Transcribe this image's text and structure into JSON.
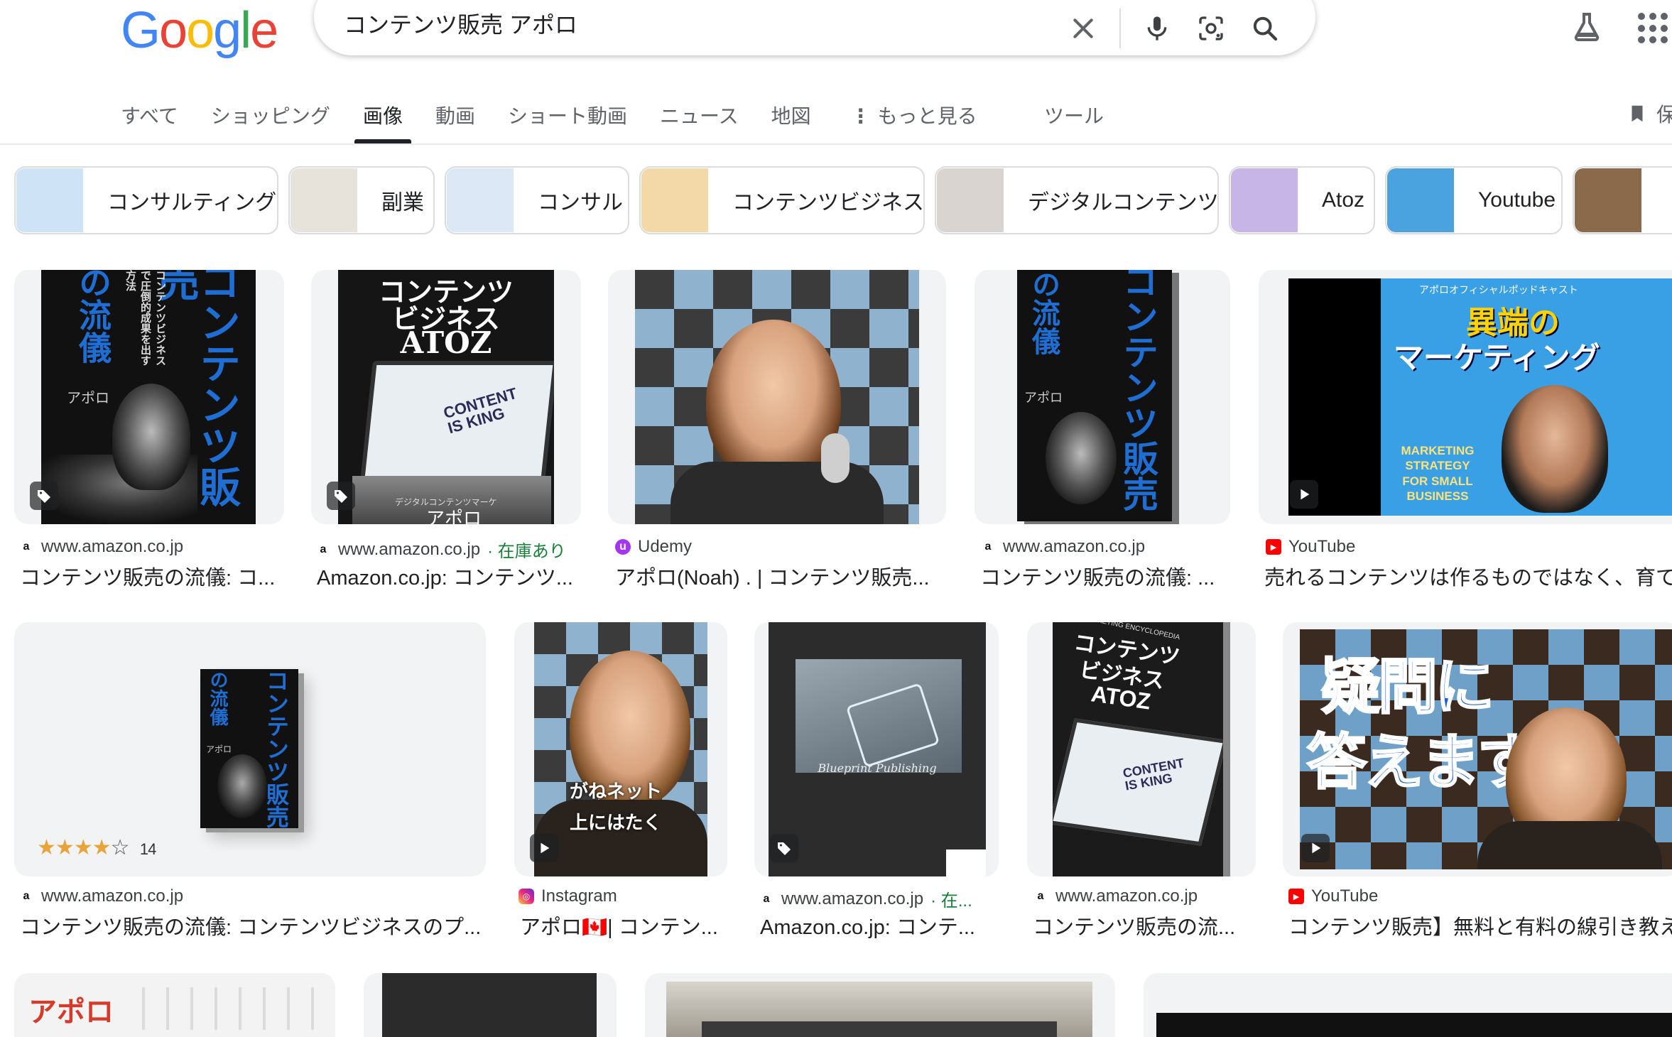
{
  "logo": {
    "letters": [
      "G",
      "o",
      "o",
      "g",
      "l",
      "e"
    ]
  },
  "search": {
    "query": "コンテンツ販売 アポロ"
  },
  "icons": {
    "clear": "close-icon",
    "voice": "microphone-icon",
    "lens": "camera-lens-icon",
    "search": "search-icon",
    "labs": "flask-icon",
    "apps": "apps-grid-icon",
    "bookmark": "bookmark-icon"
  },
  "tabs": [
    {
      "label": "すべて",
      "active": false
    },
    {
      "label": "ショッピング",
      "active": false
    },
    {
      "label": "画像",
      "active": true
    },
    {
      "label": "動画",
      "active": false
    },
    {
      "label": "ショート動画",
      "active": false
    },
    {
      "label": "ニュース",
      "active": false
    },
    {
      "label": "地図",
      "active": false
    },
    {
      "label": "もっと見る",
      "active": false
    }
  ],
  "tools_label": "ツール",
  "save_label": "保",
  "chips": [
    {
      "label": "コンサルティング",
      "color": "#cfe3f7"
    },
    {
      "label": "副業",
      "color": "#e8e3da"
    },
    {
      "label": "コンサル",
      "color": "#dce8f6"
    },
    {
      "label": "コンテンツビジネス",
      "color": "#f3d9a8"
    },
    {
      "label": "デジタルコンテンツ",
      "color": "#d9d4cf"
    },
    {
      "label": "Atoz",
      "color": "#c6b5e6"
    },
    {
      "label": "Youtube",
      "color": "#4aa3df"
    },
    {
      "label": "",
      "color": "#8a6a4a"
    }
  ],
  "results_row1": [
    {
      "source": "www.amazon.co.jp",
      "source_extra": "",
      "title": "コンテンツ販売の流儀: コ...",
      "favicon": "amazon"
    },
    {
      "source": "www.amazon.co.jp",
      "source_extra": "· 在庫あり",
      "title": "Amazon.co.jp: コンテンツ...",
      "favicon": "amazon"
    },
    {
      "source": "Udemy",
      "source_extra": "",
      "title": "アポロ(Noah) . | コンテンツ販売...",
      "favicon": "udemy"
    },
    {
      "source": "www.amazon.co.jp",
      "source_extra": "",
      "title": "コンテンツ販売の流儀: ...",
      "favicon": "amazon"
    },
    {
      "source": "YouTube",
      "source_extra": "",
      "title": "売れるコンテンツは作るものではなく、育て",
      "favicon": "youtube"
    }
  ],
  "results_row2": [
    {
      "source": "www.amazon.co.jp",
      "source_extra": "",
      "title": "コンテンツ販売の流儀: コンテンツビジネスのプ...",
      "favicon": "amazon"
    },
    {
      "source": "Instagram",
      "source_extra": "",
      "title": "アポロ🇨🇦| コンテン...",
      "favicon": "instagram"
    },
    {
      "source": "www.amazon.co.jp",
      "source_extra": "· 在...",
      "title": "Amazon.co.jp: コンテ...",
      "favicon": "amazon"
    },
    {
      "source": "www.amazon.co.jp",
      "source_extra": "",
      "title": "コンテンツ販売の流...",
      "favicon": "amazon"
    },
    {
      "source": "YouTube",
      "source_extra": "",
      "title": "コンテンツ販売】無料と有料の線引き教え",
      "favicon": "youtube"
    }
  ],
  "image_text": {
    "book1_title": "コンテンツ販売",
    "book1_sub": "の流儀",
    "book1_tagline": "コンテンツビジネスで圧倒的成果を出す方法",
    "book1_author": "アポロ",
    "atoz_title_1": "コンテンツ",
    "atoz_title_2": "ビジネス",
    "atoz_title_3": "ATOZ",
    "content_is_king": "CONTENT IS KING",
    "atoz_footer": "デジタルコンテンツマーケ",
    "atoz_author": "アポロ",
    "podcast_label": "アポロオフィシャルポッドキャスト",
    "podcast_title_1": "異端の",
    "podcast_title_2": "マーケティング",
    "podcast_en": "MARKETING STRATEGY FOR SMALL BUSINESS",
    "rating_count": "14",
    "insta_caption_1": "がねネット",
    "insta_caption_2": "上にはたく",
    "blueprint": "Blueprint Publishing",
    "encyclopedia": "MARKETING ENCYCLOPEDIA",
    "youtube2_caption_1": "疑問に",
    "youtube2_caption_2": "答えます",
    "row3_label": "アポロ"
  },
  "rating": {
    "stars": 4,
    "out_of": 5
  }
}
